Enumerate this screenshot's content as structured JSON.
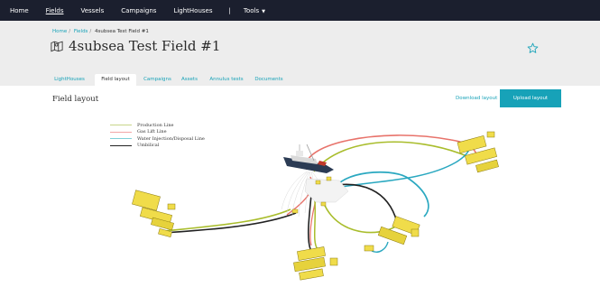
{
  "topnav": {
    "items": [
      {
        "label": "Home"
      },
      {
        "label": "Fields"
      },
      {
        "label": "Vessels"
      },
      {
        "label": "Campaigns"
      },
      {
        "label": "LightHouses"
      }
    ],
    "separator": "|",
    "tools_label": "Tools",
    "tools_caret": "▼"
  },
  "breadcrumb": {
    "home": "Home",
    "fields": "Fields",
    "current": "4subsea Test Field #1"
  },
  "page_title": "4subsea Test Field #1",
  "tabs": [
    {
      "label": "LightHouses"
    },
    {
      "label": "Field layout"
    },
    {
      "label": "Campaigns"
    },
    {
      "label": "Assets"
    },
    {
      "label": "Annulus tests"
    },
    {
      "label": "Documents"
    }
  ],
  "active_tab": "Field layout",
  "section_title": "Field layout",
  "download_label": "Download layout",
  "upload_label": "Upload layout",
  "legend": [
    {
      "label": "Production Line",
      "color": "#c8d68a"
    },
    {
      "label": "Gas Lift Line",
      "color": "#f2a6a6"
    },
    {
      "label": "Water Injection/Disposal Line",
      "color": "#7fd0d8"
    },
    {
      "label": "Umbilical",
      "color": "#222222"
    }
  ],
  "colors": {
    "nav_bg": "#1b1f2e",
    "accent": "#17a2b8",
    "header_bg": "#ededed",
    "template_yellow": "#e6d23c",
    "production": "#a9bd2c",
    "gaslift": "#e8736b",
    "water": "#2aa8c0",
    "umbilical": "#222222"
  }
}
